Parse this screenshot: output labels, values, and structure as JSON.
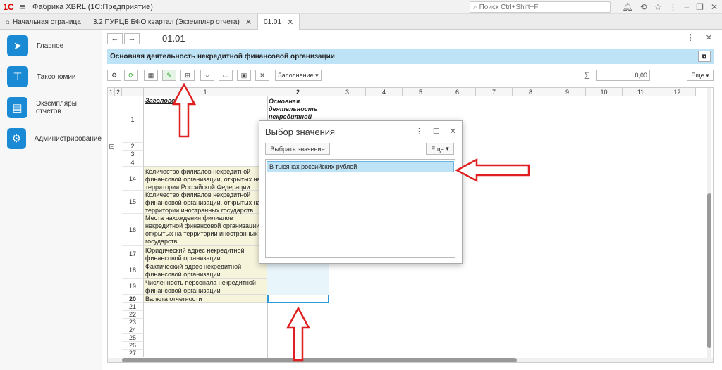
{
  "app": {
    "logo": "1С",
    "title": "Фабрика XBRL  (1С:Предприятие)"
  },
  "search": {
    "placeholder": "Поиск Ctrl+Shift+F"
  },
  "top_icons": [
    "bell-icon",
    "history-icon",
    "star-icon",
    "menu-dots-icon",
    "minimize-icon",
    "restore-icon",
    "close-icon"
  ],
  "tabs": [
    {
      "label": "Начальная страница"
    },
    {
      "label": "3.2 ПУРЦБ БФО квартал (Экземпляр отчета)"
    },
    {
      "label": "01.01"
    }
  ],
  "sidebar": {
    "items": [
      {
        "label": "Главное"
      },
      {
        "label": "Таксономии"
      },
      {
        "label": "Экземпляры отчетов"
      },
      {
        "label": "Администрирование"
      }
    ]
  },
  "form": {
    "title": "01.01",
    "section_title": "Основная деятельность некредитной финансовой организации",
    "fill_button": "Заполнение",
    "sum_value": "0,00",
    "more_button": "Еще"
  },
  "grid": {
    "columns": [
      "1",
      "2",
      "3",
      "4",
      "5",
      "6",
      "7",
      "8",
      "9",
      "10",
      "11",
      "12"
    ],
    "outline_levels": [
      "1",
      "2"
    ],
    "header_text": "Заголовок",
    "col2_header": "Основная деятельность некредитной финансовой",
    "rows": [
      {
        "num": "1",
        "text": ""
      },
      {
        "num": "2",
        "text": ""
      },
      {
        "num": "3",
        "text": ""
      },
      {
        "num": "4",
        "text": ""
      },
      {
        "num": "14",
        "text": "Количество филиалов некредитной финансовой организации, открытых на территории Российской Федерации"
      },
      {
        "num": "15",
        "text": "Количество филиалов некредитной финансовой организации, открытых на территории иностранных государств"
      },
      {
        "num": "16",
        "text": "Места нахождения филиалов некредитной финансовой организации, открытых на территории иностранных государств"
      },
      {
        "num": "17",
        "text": "Юридический адрес некредитной финансовой организации"
      },
      {
        "num": "18",
        "text": "Фактический адрес некредитной финансовой организации"
      },
      {
        "num": "19",
        "text": "Численность персонала некредитной финансовой организации"
      },
      {
        "num": "20",
        "text": "Валюта отчетности"
      },
      {
        "num": "21",
        "text": ""
      },
      {
        "num": "22",
        "text": ""
      },
      {
        "num": "23",
        "text": ""
      },
      {
        "num": "24",
        "text": ""
      },
      {
        "num": "25",
        "text": ""
      },
      {
        "num": "26",
        "text": ""
      },
      {
        "num": "27",
        "text": ""
      }
    ]
  },
  "modal": {
    "title": "Выбор значения",
    "select_button": "Выбрать значение",
    "more_button": "Еще",
    "items": [
      "В тысячах российских рублей"
    ]
  },
  "colors": {
    "accent": "#1a8ad4",
    "highlight": "#bfe3f6",
    "annotation": "#e02020"
  }
}
